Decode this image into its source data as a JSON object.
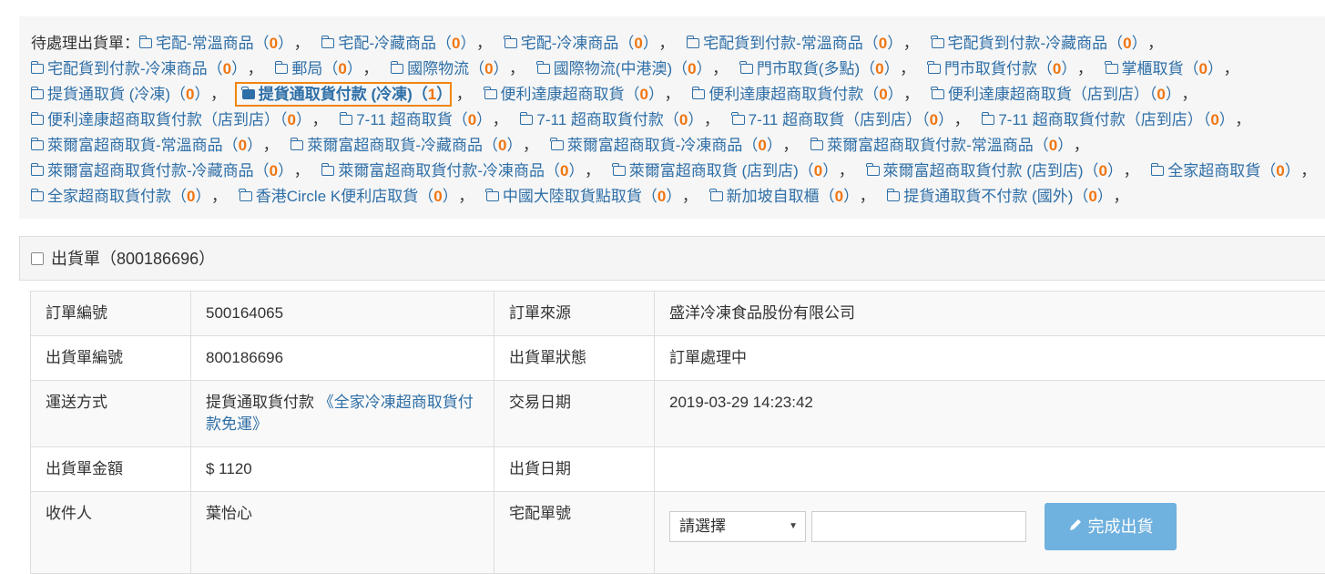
{
  "pending": {
    "label": "待處理出貨單：",
    "items": [
      {
        "name": "宅配-常溫商品",
        "count": "0"
      },
      {
        "name": "宅配-冷藏商品",
        "count": "0"
      },
      {
        "name": "宅配-冷凍商品",
        "count": "0"
      },
      {
        "name": "宅配貨到付款-常溫商品",
        "count": "0"
      },
      {
        "name": "宅配貨到付款-冷藏商品",
        "count": "0"
      },
      {
        "name": "宅配貨到付款-冷凍商品",
        "count": "0"
      },
      {
        "name": "郵局",
        "count": "0"
      },
      {
        "name": "國際物流",
        "count": "0"
      },
      {
        "name": "國際物流(中港澳)",
        "count": "0"
      },
      {
        "name": "門市取貨(多點)",
        "count": "0"
      },
      {
        "name": "門市取貨付款",
        "count": "0"
      },
      {
        "name": "掌櫃取貨",
        "count": "0"
      },
      {
        "name": "提貨通取貨 (冷凍)",
        "count": "0"
      },
      {
        "name": "提貨通取貨付款 (冷凍)",
        "count": "1"
      },
      {
        "name": "便利達康超商取貨",
        "count": "0"
      },
      {
        "name": "便利達康超商取貨付款",
        "count": "0"
      },
      {
        "name": "便利達康超商取貨（店到店）",
        "count": "0"
      },
      {
        "name": "便利達康超商取貨付款（店到店）",
        "count": "0"
      },
      {
        "name": "7-11 超商取貨",
        "count": "0"
      },
      {
        "name": "7-11 超商取貨付款",
        "count": "0"
      },
      {
        "name": "7-11 超商取貨（店到店）",
        "count": "0"
      },
      {
        "name": "7-11 超商取貨付款（店到店）",
        "count": "0"
      },
      {
        "name": "萊爾富超商取貨-常溫商品",
        "count": "0"
      },
      {
        "name": "萊爾富超商取貨-冷藏商品",
        "count": "0"
      },
      {
        "name": "萊爾富超商取貨-冷凍商品",
        "count": "0"
      },
      {
        "name": "萊爾富超商取貨付款-常溫商品",
        "count": "0"
      },
      {
        "name": "萊爾富超商取貨付款-冷藏商品",
        "count": "0"
      },
      {
        "name": "萊爾富超商取貨付款-冷凍商品",
        "count": "0"
      },
      {
        "name": "萊爾富超商取貨 (店到店)",
        "count": "0"
      },
      {
        "name": "萊爾富超商取貨付款 (店到店)",
        "count": "0"
      },
      {
        "name": "全家超商取貨",
        "count": "0"
      },
      {
        "name": "全家超商取貨付款",
        "count": "0"
      },
      {
        "name": "香港Circle K便利店取貨",
        "count": "0"
      },
      {
        "name": "中國大陸取貨點取貨",
        "count": "0"
      },
      {
        "name": "新加坡自取櫃",
        "count": "0"
      },
      {
        "name": "提貨通取貨不付款 (國外)",
        "count": "0"
      }
    ],
    "active_index": 13
  },
  "panel": {
    "title_prefix": "出貨單（",
    "id": "800186696",
    "title_suffix": "）"
  },
  "details": {
    "order_no_label": "訂單編號",
    "order_no": "500164065",
    "source_label": "訂單來源",
    "source": "盛洋冷凍食品股份有限公司",
    "ship_no_label": "出貨單編號",
    "ship_no": "800186696",
    "status_label": "出貨單狀態",
    "status": "訂單處理中",
    "method_label": "運送方式",
    "method": "提貨通取貨付款",
    "method_link": "《全家冷凍超商取貨付款免運》",
    "date_label": "交易日期",
    "date": "2019-03-29 14:23:42",
    "amount_label": "出貨單金額",
    "amount": "$ 1120",
    "ship_date_label": "出貨日期",
    "ship_date": "",
    "receiver_label": "收件人",
    "receiver": "葉怡心",
    "tracking_label": "宅配單號",
    "select_placeholder": "請選擇",
    "complete_button": "完成出貨"
  }
}
